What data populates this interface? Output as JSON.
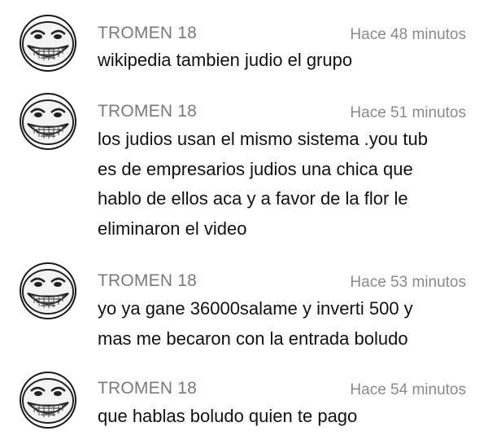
{
  "comments": [
    {
      "author": "TROMEN 18",
      "time": "Hace 48 minutos",
      "text": "wikipedia tambien judio el grupo",
      "avatar_icon": "trollface-icon"
    },
    {
      "author": "TROMEN 18",
      "time": "Hace 51 minutos",
      "text": "los judios usan el mismo sistema .you tub\nes de empresarios judios una chica que\nhablo de ellos aca y a favor de la flor le\neliminaron el video",
      "avatar_icon": "trollface-icon"
    },
    {
      "author": "TROMEN 18",
      "time": "Hace 53 minutos",
      "text": "yo ya gane 36000salame y inverti 500 y\nmas me becaron con la entrada boludo",
      "avatar_icon": "trollface-icon"
    },
    {
      "author": "TROMEN 18",
      "time": "Hace 54 minutos",
      "text": "que hablas boludo quien te pago",
      "avatar_icon": "trollface-icon"
    }
  ],
  "colors": {
    "author": "#7a7a7a",
    "time": "#8a8a8a",
    "text": "#111111",
    "background": "#ffffff"
  }
}
